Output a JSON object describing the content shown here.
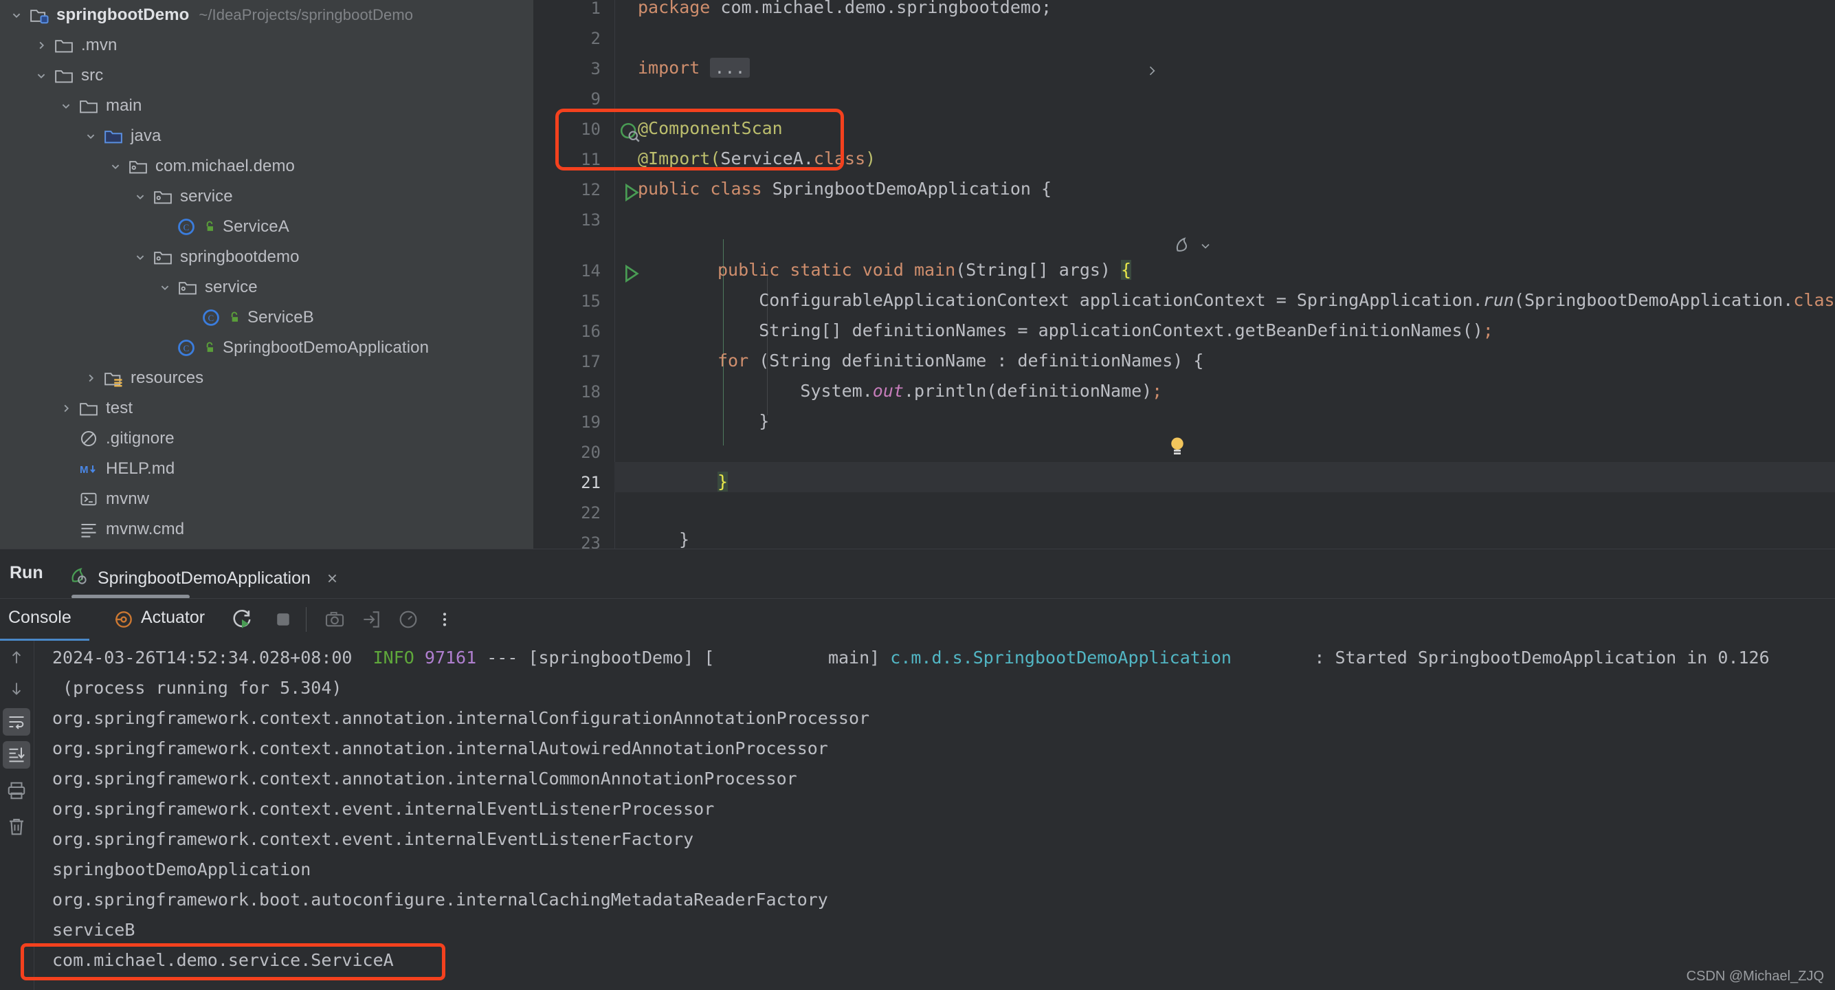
{
  "project_tree": {
    "rows": [
      {
        "label": "springbootDemo",
        "path": "~/IdeaProjects/springbootDemo",
        "indent": 0,
        "chevron": "down",
        "icon": "project-folder-icon",
        "bold": true
      },
      {
        "label": ".mvn",
        "path": "",
        "indent": 1,
        "chevron": "right",
        "icon": "folder-icon",
        "bold": false
      },
      {
        "label": "src",
        "path": "",
        "indent": 1,
        "chevron": "down",
        "icon": "folder-icon",
        "bold": false
      },
      {
        "label": "main",
        "path": "",
        "indent": 2,
        "chevron": "down",
        "icon": "folder-icon",
        "bold": false
      },
      {
        "label": "java",
        "path": "",
        "indent": 3,
        "chevron": "down",
        "icon": "source-root-folder-icon",
        "bold": false
      },
      {
        "label": "com.michael.demo",
        "path": "",
        "indent": 4,
        "chevron": "down",
        "icon": "package-icon",
        "bold": false
      },
      {
        "label": "service",
        "path": "",
        "indent": 5,
        "chevron": "down",
        "icon": "package-icon",
        "bold": false
      },
      {
        "label": "ServiceA",
        "path": "",
        "indent": 6,
        "chevron": "none",
        "icon": "java-class-icon",
        "bold": false
      },
      {
        "label": "springbootdemo",
        "path": "",
        "indent": 5,
        "chevron": "down",
        "icon": "package-icon",
        "bold": false
      },
      {
        "label": "service",
        "path": "",
        "indent": 6,
        "chevron": "down",
        "icon": "package-icon",
        "bold": false
      },
      {
        "label": "ServiceB",
        "path": "",
        "indent": 7,
        "chevron": "none",
        "icon": "java-class-icon",
        "bold": false
      },
      {
        "label": "SpringbootDemoApplication",
        "path": "",
        "indent": 6,
        "chevron": "none",
        "icon": "java-class-icon",
        "bold": false
      },
      {
        "label": "resources",
        "path": "",
        "indent": 3,
        "chevron": "right",
        "icon": "resources-folder-icon",
        "bold": false
      },
      {
        "label": "test",
        "path": "",
        "indent": 2,
        "chevron": "right",
        "icon": "folder-icon",
        "bold": false
      },
      {
        "label": ".gitignore",
        "path": "",
        "indent": 2,
        "chevron": "none",
        "icon": "gitignore-icon",
        "bold": false
      },
      {
        "label": "HELP.md",
        "path": "",
        "indent": 2,
        "chevron": "none",
        "icon": "markdown-icon",
        "bold": false
      },
      {
        "label": "mvnw",
        "path": "",
        "indent": 2,
        "chevron": "none",
        "icon": "terminal-script-icon",
        "bold": false
      },
      {
        "label": "mvnw.cmd",
        "path": "",
        "indent": 2,
        "chevron": "none",
        "icon": "text-file-icon",
        "bold": false
      }
    ]
  },
  "editor": {
    "line_numbers": [
      "1",
      "2",
      "3",
      "9",
      "10",
      "11",
      "12",
      "13",
      "14",
      "15",
      "16",
      "17",
      "18",
      "19",
      "20",
      "21",
      "22",
      "23"
    ],
    "current_line": "21",
    "folded_placeholder": "...",
    "code": {
      "l1_kw": "package",
      "l1_rest": " com.michael.demo.springbootdemo;",
      "l3_kw": "import",
      "l10_anno": "@ComponentScan",
      "l11_anno": "@Import",
      "l11_paren_open": "(",
      "l11_arg": "ServiceA.",
      "l11_class_kw": "class",
      "l11_paren_close": ")",
      "l12_kw": "public class ",
      "l12_name": "SpringbootDemoApplication {",
      "l14_mods": "public static void ",
      "l14_name": "main",
      "l14_args": "(String[] args) ",
      "l14_brace": "{",
      "l15": "    ConfigurableApplicationContext applicationContext = SpringApplication.",
      "l15_run": "run",
      "l15_tail": "(SpringbootDemoApplication.",
      "l15_class": "class",
      "l16": "    String[] definitionNames = applicationContext.getBeanDefinitionNames()",
      "l16_semi": ";",
      "l17_kw": "for",
      "l17_rest": " (String definitionName : definitionNames) {",
      "l18_a": "        System.",
      "l18_out": "out",
      "l18_b": ".println(definitionName)",
      "l18_semi": ";",
      "l19": "    }",
      "l21": "}",
      "l23": "}"
    },
    "highlight_box_label": "annotation-highlight-box",
    "accent_red": "#f4411e"
  },
  "run_panel": {
    "title": "Run",
    "tab_label": "SpringbootDemoApplication",
    "close_label": "×",
    "console_tab": "Console",
    "actuator_tab": "Actuator",
    "toolbar_icons": [
      "rerun-icon",
      "stop-icon",
      "screenshot-icon",
      "export-to-file-icon",
      "dashboard-icon",
      "more-options-icon"
    ],
    "side_icons": [
      "scroll-up-icon",
      "scroll-down-icon",
      "soft-wrap-icon",
      "scroll-to-end-icon",
      "print-icon",
      "clear-all-icon"
    ]
  },
  "console": {
    "lines": [
      {
        "type": "log",
        "ts": "2024-03-26T14:52:34.028+08:00",
        "level": "INFO",
        "pid": "97161",
        "dashes": "---",
        "app": "[springbootDemo]",
        "thread": "[           main]",
        "logger": "c.m.d.s.SpringbootDemoApplication",
        "sep": ": ",
        "msg": "Started SpringbootDemoApplication in 0.126"
      },
      {
        "type": "plain",
        "text": " (process running for 5.304)"
      },
      {
        "type": "plain",
        "text": "org.springframework.context.annotation.internalConfigurationAnnotationProcessor"
      },
      {
        "type": "plain",
        "text": "org.springframework.context.annotation.internalAutowiredAnnotationProcessor"
      },
      {
        "type": "plain",
        "text": "org.springframework.context.annotation.internalCommonAnnotationProcessor"
      },
      {
        "type": "plain",
        "text": "org.springframework.context.event.internalEventListenerProcessor"
      },
      {
        "type": "plain",
        "text": "org.springframework.context.event.internalEventListenerFactory"
      },
      {
        "type": "plain",
        "text": "springbootDemoApplication"
      },
      {
        "type": "plain",
        "text": "org.springframework.boot.autoconfigure.internalCachingMetadataReaderFactory"
      },
      {
        "type": "plain",
        "text": "serviceB"
      },
      {
        "type": "plain",
        "text": "com.michael.demo.service.ServiceA"
      }
    ],
    "highlighted_line_index": 10
  },
  "watermark": "CSDN @Michael_ZJQ"
}
